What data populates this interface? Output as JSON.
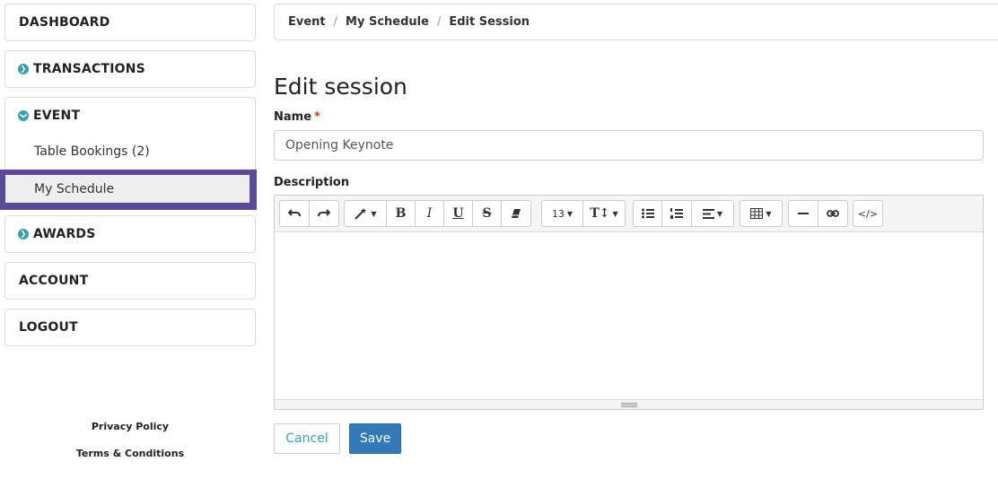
{
  "sidebar": {
    "dashboard": "DASHBOARD",
    "transactions": "TRANSACTIONS",
    "event": "EVENT",
    "event_items": [
      "Table Bookings (2)",
      "My Schedule"
    ],
    "awards": "AWARDS",
    "account": "ACCOUNT",
    "logout": "LOGOUT",
    "privacy": "Privacy Policy",
    "terms": "Terms & Conditions"
  },
  "breadcrumb": [
    "Event",
    "My Schedule",
    "Edit Session"
  ],
  "breadcrumb_sep": "/",
  "form": {
    "title": "Edit session",
    "name_label": "Name",
    "required_mark": "*",
    "name_value": "Opening Keynote",
    "description_label": "Description"
  },
  "toolbar": {
    "font_size": "13",
    "text_height_label": "T↕"
  },
  "actions": {
    "cancel": "Cancel",
    "save": "Save"
  },
  "colors": {
    "accent": "#3a9fb0",
    "active_outline": "#5b4a9a",
    "primary": "#337ab7"
  }
}
